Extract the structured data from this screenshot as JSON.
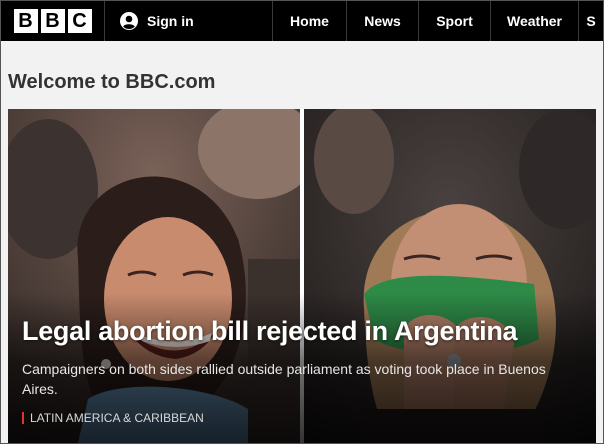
{
  "logo": {
    "letters": [
      "B",
      "B",
      "C"
    ]
  },
  "header": {
    "signin_label": "Sign in",
    "nav": [
      {
        "label": "Home"
      },
      {
        "label": "News"
      },
      {
        "label": "Sport"
      },
      {
        "label": "Weather"
      },
      {
        "label": "S"
      }
    ]
  },
  "page": {
    "title": "Welcome to BBC.com"
  },
  "hero": {
    "headline": "Legal abortion bill rejected in Argentina",
    "summary": "Campaigners on both sides rallied outside parliament as voting took place in Buenos Aires.",
    "section": "LATIN AMERICA & CARIBBEAN",
    "section_color": "#e4322c"
  },
  "icons": {
    "signin": "user-icon"
  }
}
